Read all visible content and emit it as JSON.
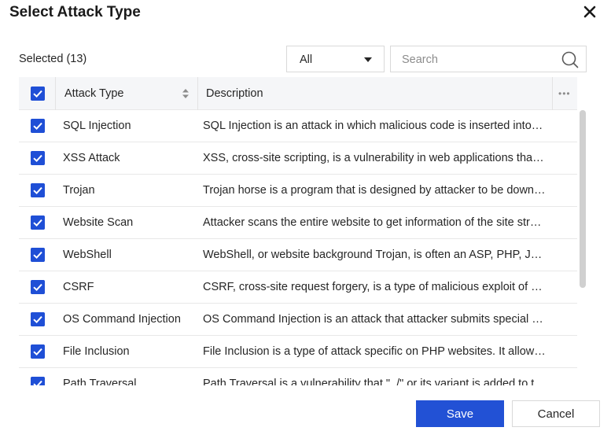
{
  "dialog": {
    "title": "Select Attack Type",
    "close_icon": "close-icon"
  },
  "toolbar": {
    "selected_label": "Selected (13)",
    "filter_value": "All",
    "search_placeholder": "Search",
    "search_value": ""
  },
  "table": {
    "columns": {
      "type": "Attack Type",
      "description": "Description"
    },
    "rows": [
      {
        "checked": true,
        "type": "SQL Injection",
        "description": "SQL Injection is an attack in which malicious code is inserted into strings that are later passed to the database."
      },
      {
        "checked": true,
        "type": "XSS Attack",
        "description": "XSS, cross-site scripting, is a vulnerability in web applications that allows attackers to inject scripts."
      },
      {
        "checked": true,
        "type": "Trojan",
        "description": "Trojan horse is a program that is designed by attacker to be downloaded and run by the victim."
      },
      {
        "checked": true,
        "type": "Website Scan",
        "description": "Attacker scans the entire website to get information of the site structure and vulnerabilities."
      },
      {
        "checked": true,
        "type": "WebShell",
        "description": "WebShell, or website background Trojan, is often an ASP, PHP, JSP or CGI web page file."
      },
      {
        "checked": true,
        "type": "CSRF",
        "description": "CSRF, cross-site request forgery, is a type of malicious exploit of a website."
      },
      {
        "checked": true,
        "type": "OS Command Injection",
        "description": "OS Command Injection is an attack that attacker submits special commands to the server."
      },
      {
        "checked": true,
        "type": "File Inclusion",
        "description": "File Inclusion is a type of attack specific on PHP websites. It allows attackers to include files."
      },
      {
        "checked": true,
        "type": "Path Traversal",
        "description": "Path Traversal is a vulnerability that \"../\" or its variant is added to the path."
      }
    ]
  },
  "footer": {
    "save_label": "Save",
    "cancel_label": "Cancel"
  },
  "colors": {
    "accent": "#2251d5",
    "checkbox": "#1f4fd6",
    "header_bg": "#f5f6f8",
    "border": "#e8e8e8"
  }
}
